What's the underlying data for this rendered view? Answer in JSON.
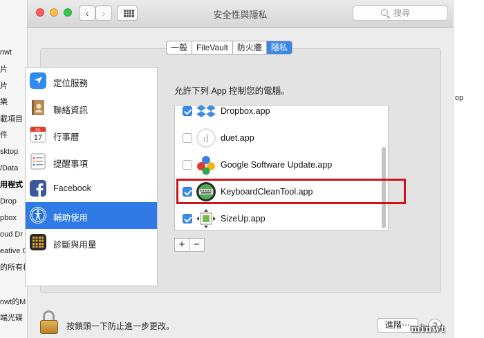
{
  "background_finder": {
    "sidebar_fragments": [
      "nwt",
      "片",
      "片",
      "樂",
      "載項目",
      "件",
      "sktop",
      "/Data",
      "用程式",
      "Drop",
      "pbox",
      "oud Dr",
      "eative C",
      "的所有檔",
      "nwt的M",
      "端光碟"
    ],
    "selected_fragment": "用程式",
    "right_fragment": "op"
  },
  "window": {
    "title": "安全性與隱私",
    "search_placeholder": "搜尋",
    "nav_back": "‹",
    "nav_forward": "›"
  },
  "tabs": [
    {
      "label": "一般",
      "active": false
    },
    {
      "label": "FileVault",
      "active": false
    },
    {
      "label": "防火牆",
      "active": false
    },
    {
      "label": "隱私",
      "active": true
    }
  ],
  "categories": [
    {
      "label": "定位服務",
      "icon": "location-arrow-icon",
      "color": "#2f8bf0",
      "active": false
    },
    {
      "label": "聯絡資訊",
      "icon": "contacts-book-icon",
      "color": "#b98a52",
      "active": false
    },
    {
      "label": "行事曆",
      "icon": "calendar-icon",
      "color": "#ffffff",
      "active": false,
      "day": "17",
      "month": "JUL"
    },
    {
      "label": "提醒事項",
      "icon": "reminders-list-icon",
      "color": "#ffffff",
      "active": false
    },
    {
      "label": "Facebook",
      "icon": "facebook-icon",
      "color": "#3b5998",
      "active": false
    },
    {
      "label": "輔助使用",
      "icon": "accessibility-icon",
      "color": "#1e6fd8",
      "active": true
    },
    {
      "label": "診斷與用量",
      "icon": "diagnostics-grid-icon",
      "color": "#2b2b2b",
      "active": false
    }
  ],
  "prompt": "允許下列 App 控制您的電腦。",
  "apps": [
    {
      "name": "Dropbox.app",
      "checked": true,
      "icon": "dropbox-icon"
    },
    {
      "name": "duet.app",
      "checked": false,
      "icon": "duet-icon"
    },
    {
      "name": "Google Software Update.app",
      "checked": false,
      "icon": "google-software-update-icon"
    },
    {
      "name": "KeyboardCleanTool.app",
      "checked": true,
      "icon": "keyboard-clean-tool-icon"
    },
    {
      "name": "SizeUp.app",
      "checked": true,
      "icon": "sizeup-icon"
    }
  ],
  "list_buttons": {
    "add": "+",
    "remove": "−"
  },
  "highlighted_app": "KeyboardCleanTool.app",
  "highlight_color": "#d0121b",
  "footer": {
    "lock_text": "按鎖頭一下防止進一步更改。",
    "advanced_label": "進階⋯",
    "help_label": "?"
  },
  "watermark": "minwt"
}
